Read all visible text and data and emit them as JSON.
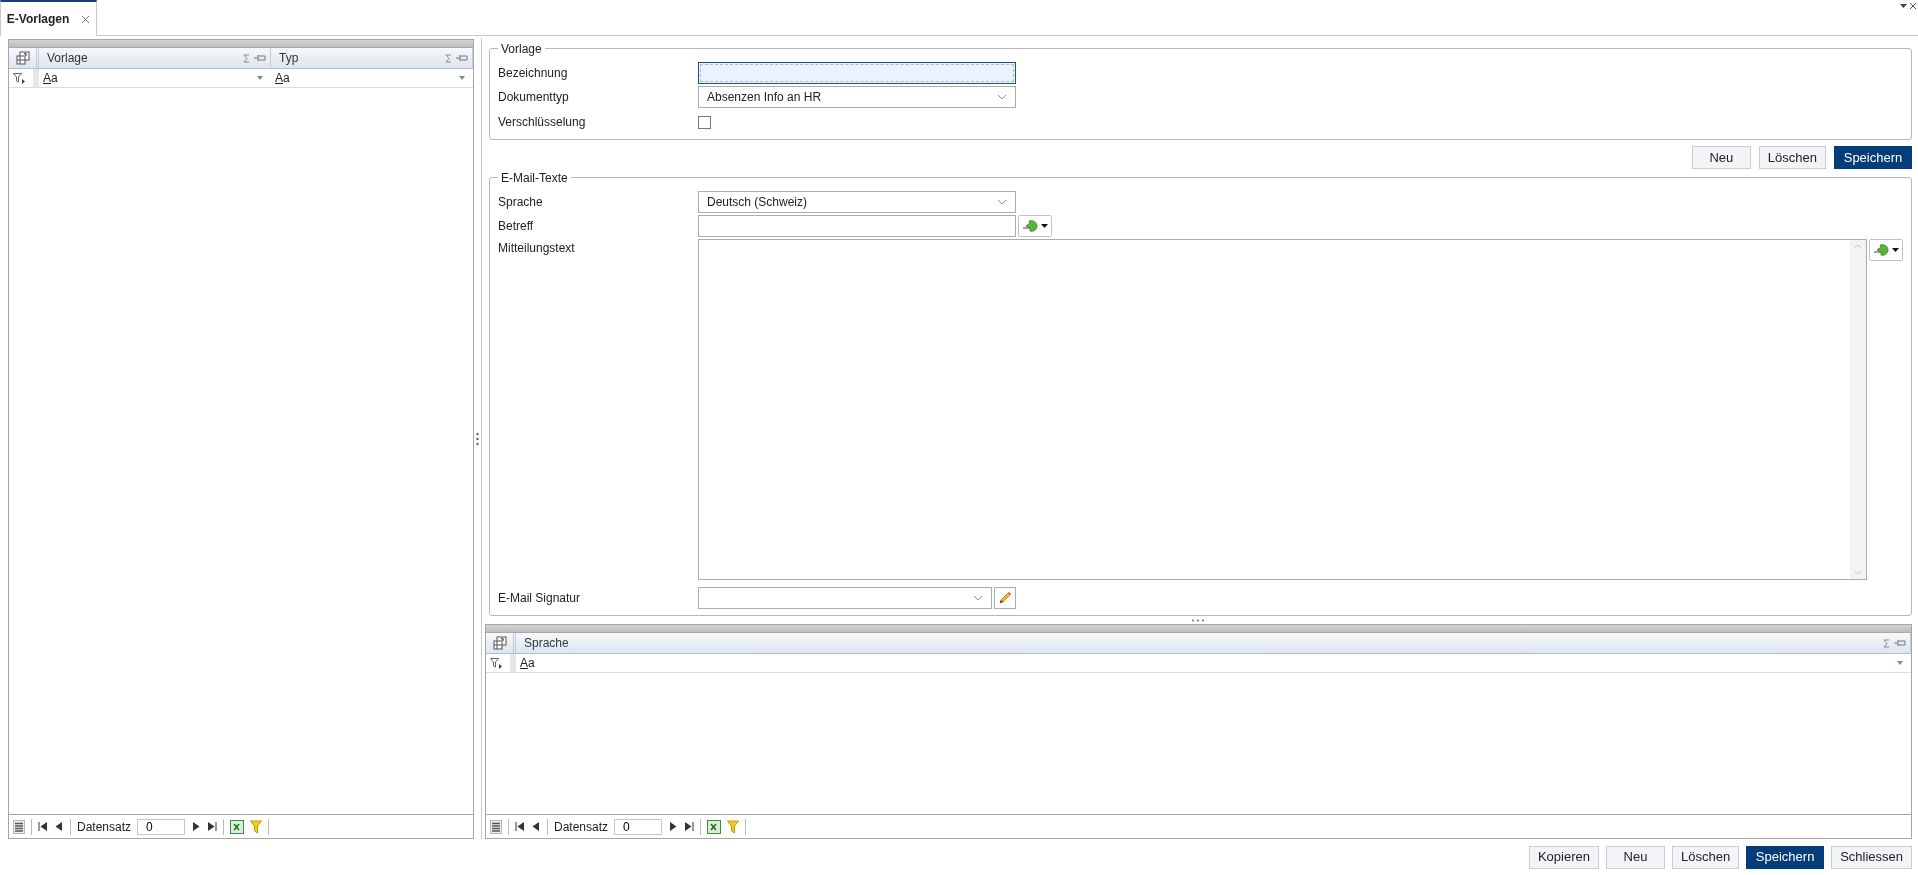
{
  "tab": {
    "label": "E-Vorlagen",
    "selected": true
  },
  "left_grid": {
    "columns": [
      {
        "header": "Vorlage",
        "filter": "Aa"
      },
      {
        "header": "Typ",
        "filter": "Aa"
      }
    ],
    "navigator": {
      "label": "Datensatz",
      "value": "0"
    }
  },
  "vorlage": {
    "legend": "Vorlage",
    "fields": [
      {
        "kind": "text",
        "label": "Bezeichnung",
        "focused": true
      },
      {
        "kind": "select",
        "label": "Dokumenttyp",
        "value": "Absenzen Info an HR"
      },
      {
        "kind": "checkbox",
        "label": "Verschlüsselung",
        "checked": false
      }
    ]
  },
  "form_buttons": [
    {
      "label": "Neu",
      "primary": false
    },
    {
      "label": "Löschen",
      "primary": false
    },
    {
      "label": "Speichern",
      "primary": true
    }
  ],
  "email_texts": {
    "legend": "E-Mail-Texte",
    "fields": [
      {
        "kind": "select",
        "label": "Sprache",
        "value": "Deutsch (Schweiz)"
      },
      {
        "kind": "insert-text",
        "label": "Betreff"
      },
      {
        "kind": "insert-area",
        "label": "Mitteilungstext"
      },
      {
        "kind": "edit-select",
        "label": "E-Mail Signatur"
      }
    ]
  },
  "bottom_grid": {
    "columns": [
      {
        "header": "Sprache",
        "filter": "Aa"
      }
    ],
    "navigator": {
      "label": "Datensatz",
      "value": "0"
    }
  },
  "footer_buttons": [
    {
      "label": "Kopieren",
      "primary": false
    },
    {
      "label": "Neu",
      "primary": false
    },
    {
      "label": "Löschen",
      "primary": false
    },
    {
      "label": "Speichern",
      "primary": true
    },
    {
      "label": "Schliessen",
      "primary": false
    }
  ]
}
